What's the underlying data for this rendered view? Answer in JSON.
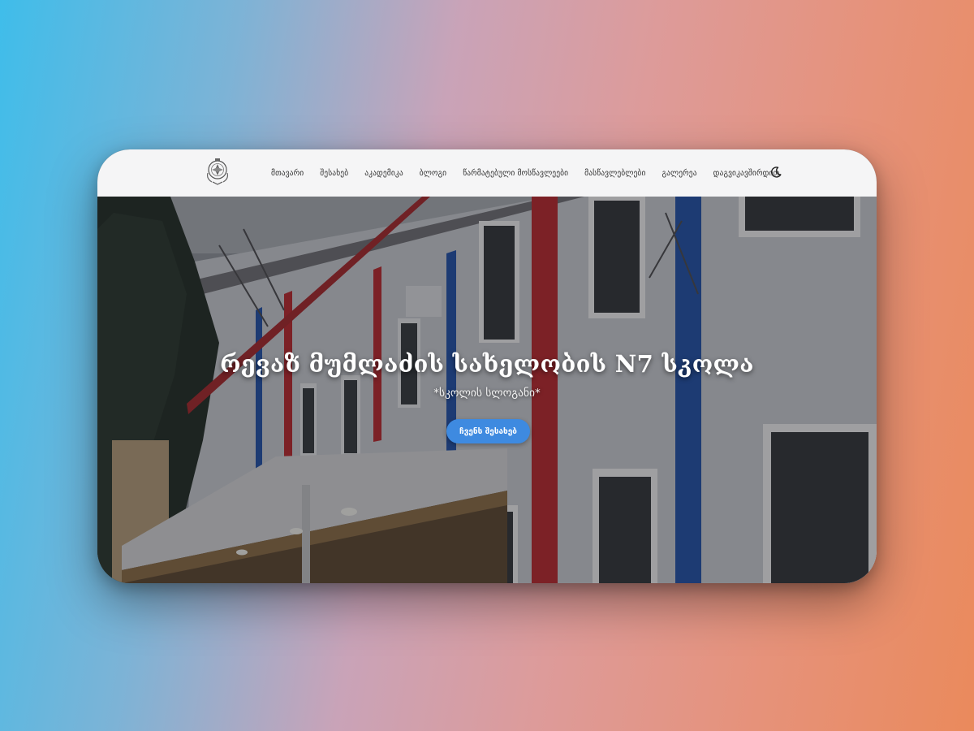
{
  "nav": {
    "logo_icon": "school-emblem-icon",
    "items": [
      {
        "label": "მთავარი"
      },
      {
        "label": "შესახებ"
      },
      {
        "label": "აკადემიკა"
      },
      {
        "label": "ბლოგი"
      },
      {
        "label": "წარმატებული მოსწავლეები"
      },
      {
        "label": "მასწავლებლები"
      },
      {
        "label": "გალერეა"
      },
      {
        "label": "დაგვიკავშირდით"
      }
    ],
    "theme_toggle_icon": "moon-icon"
  },
  "hero": {
    "title": "რევაზ მუმლაძის სახელობის N7 სკოლა",
    "slogan": "*სკოლის სლოგანი*",
    "button_label": "ჩვენს შესახებ"
  },
  "colors": {
    "accent": "#3e8ae0",
    "nav_background": "#f5f5f6",
    "building_red": "#c0272d",
    "building_blue": "#1f4fa8"
  }
}
